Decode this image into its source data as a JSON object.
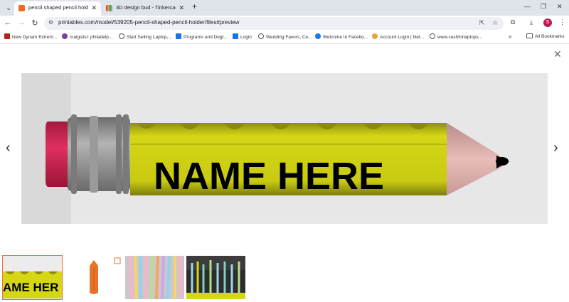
{
  "browser": {
    "tabs": [
      {
        "title": "pencil shaped pencil holder by",
        "favicon_color": "#f26a21",
        "active": true
      },
      {
        "title": "3D design bud - Tinkercad",
        "favicon_color": "#3a86c8",
        "active": false
      }
    ],
    "url": "printables.com/model/539205-pencil-shaped-pencil-holder/files#preview",
    "profile_initial": "S",
    "profile_color": "#c0174f",
    "bookmarks": [
      {
        "label": "New Dynam Extrem...",
        "icon": "x-icon",
        "color": "#b3261e"
      },
      {
        "label": "craigslist: philadelp...",
        "icon": "peace-icon",
        "color": "#7b3fa0"
      },
      {
        "label": "Start Selling Laptop,...",
        "icon": "globe-icon",
        "color": "#555555"
      },
      {
        "label": "Programs and Degr...",
        "icon": "z-icon",
        "color": "#1a73e8"
      },
      {
        "label": "Login",
        "icon": "z-icon",
        "color": "#1a73e8"
      },
      {
        "label": "Wedding Favors, Ce...",
        "icon": "globe-icon",
        "color": "#555555"
      },
      {
        "label": "Welcome to Facebo...",
        "icon": "facebook-icon",
        "color": "#1877f2"
      },
      {
        "label": "Account Login | Net...",
        "icon": "n-icon",
        "color": "#e8a33d"
      },
      {
        "label": "www.cashforlaptops...",
        "icon": "globe-icon",
        "color": "#555555"
      }
    ],
    "all_bookmarks_label": "All Bookmarks"
  },
  "preview": {
    "image_text": "NAME HERE",
    "thumbnail_text": "AME HER",
    "pencil_body_color": "#d4d616",
    "eraser_color": "#d8285c",
    "ferrule_color": "#8d8d8d",
    "tip_color": "#e4b2ae",
    "lead_color": "#000000",
    "selected_outline_color": "#f0703c"
  }
}
